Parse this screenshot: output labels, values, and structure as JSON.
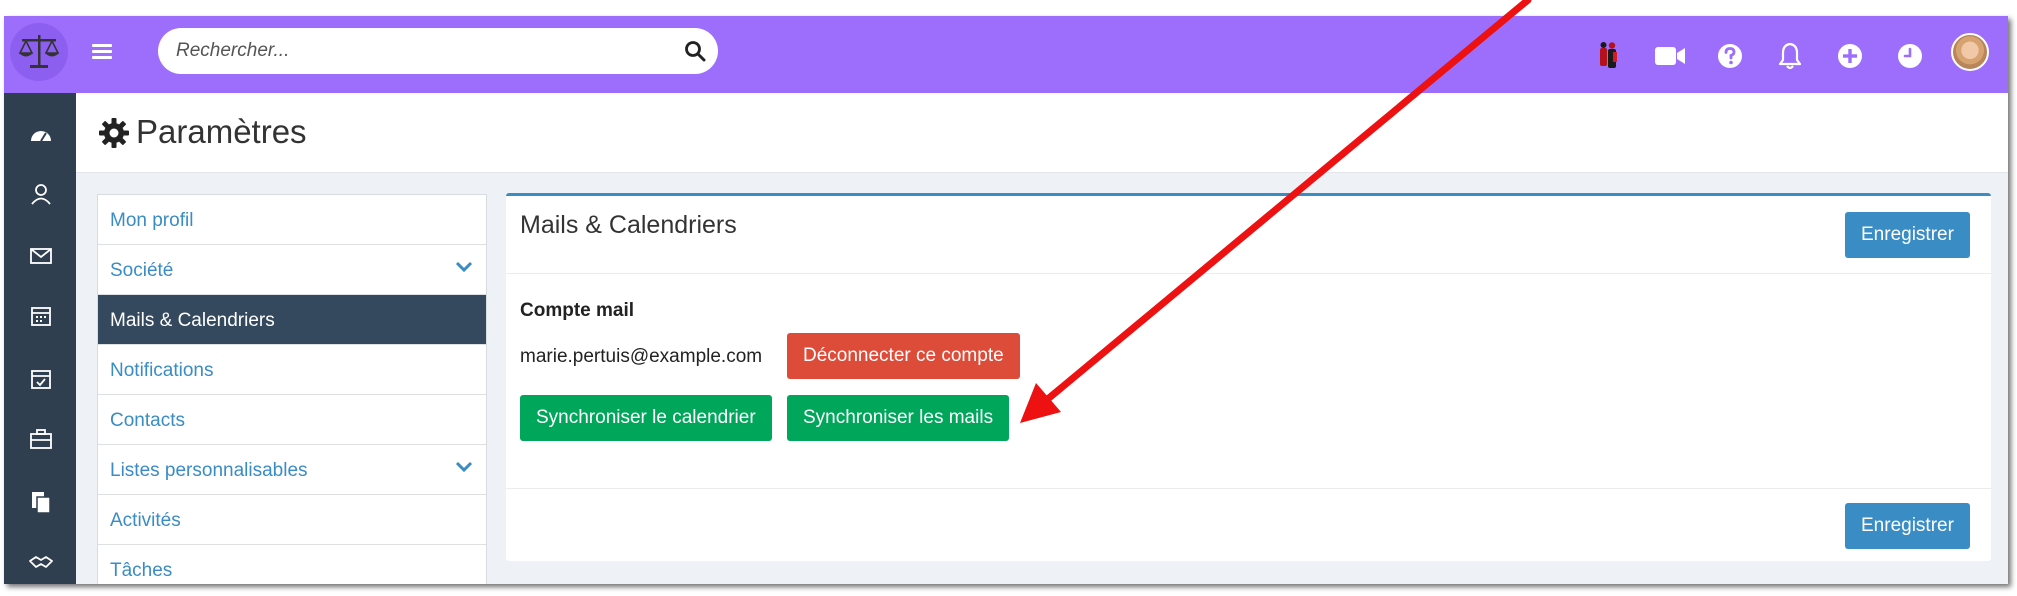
{
  "app": {
    "search": {
      "placeholder": "Rechercher..."
    },
    "top_icons": [
      "figures-icon",
      "video-camera-icon",
      "question-icon",
      "bell-icon",
      "plus-circle-icon",
      "clock-icon"
    ],
    "sidebar_icons": [
      "dashboard-icon",
      "contacts-icon",
      "mail-icon",
      "calendar-icon",
      "tasks-icon",
      "briefcase-icon",
      "documents-icon",
      "handshake-icon"
    ]
  },
  "page": {
    "title": "Paramètres"
  },
  "settings_menu": {
    "items": [
      {
        "label": "Mon profil"
      },
      {
        "label": "Société"
      },
      {
        "label": "Mails & Calendriers"
      },
      {
        "label": "Notifications"
      },
      {
        "label": "Contacts"
      },
      {
        "label": "Listes personnalisables"
      },
      {
        "label": "Activités"
      },
      {
        "label": "Tâches"
      }
    ]
  },
  "panel": {
    "title": "Mails & Calendriers",
    "save_label": "Enregistrer",
    "section_label": "Compte mail",
    "email": "marie.pertuis@example.com",
    "disconnect_label": "Déconnecter ce compte",
    "sync_calendar_label": "Synchroniser le calendrier",
    "sync_mails_label": "Synchroniser les mails"
  },
  "colors": {
    "topbar": "#9d6dfb",
    "sidebar": "#2f3f4f",
    "accent_blue": "#3a8cc4",
    "danger_red": "#dd4b39",
    "success_green": "#00a65a",
    "active_menu": "#34495e",
    "annotation_arrow": "#ee1111"
  }
}
